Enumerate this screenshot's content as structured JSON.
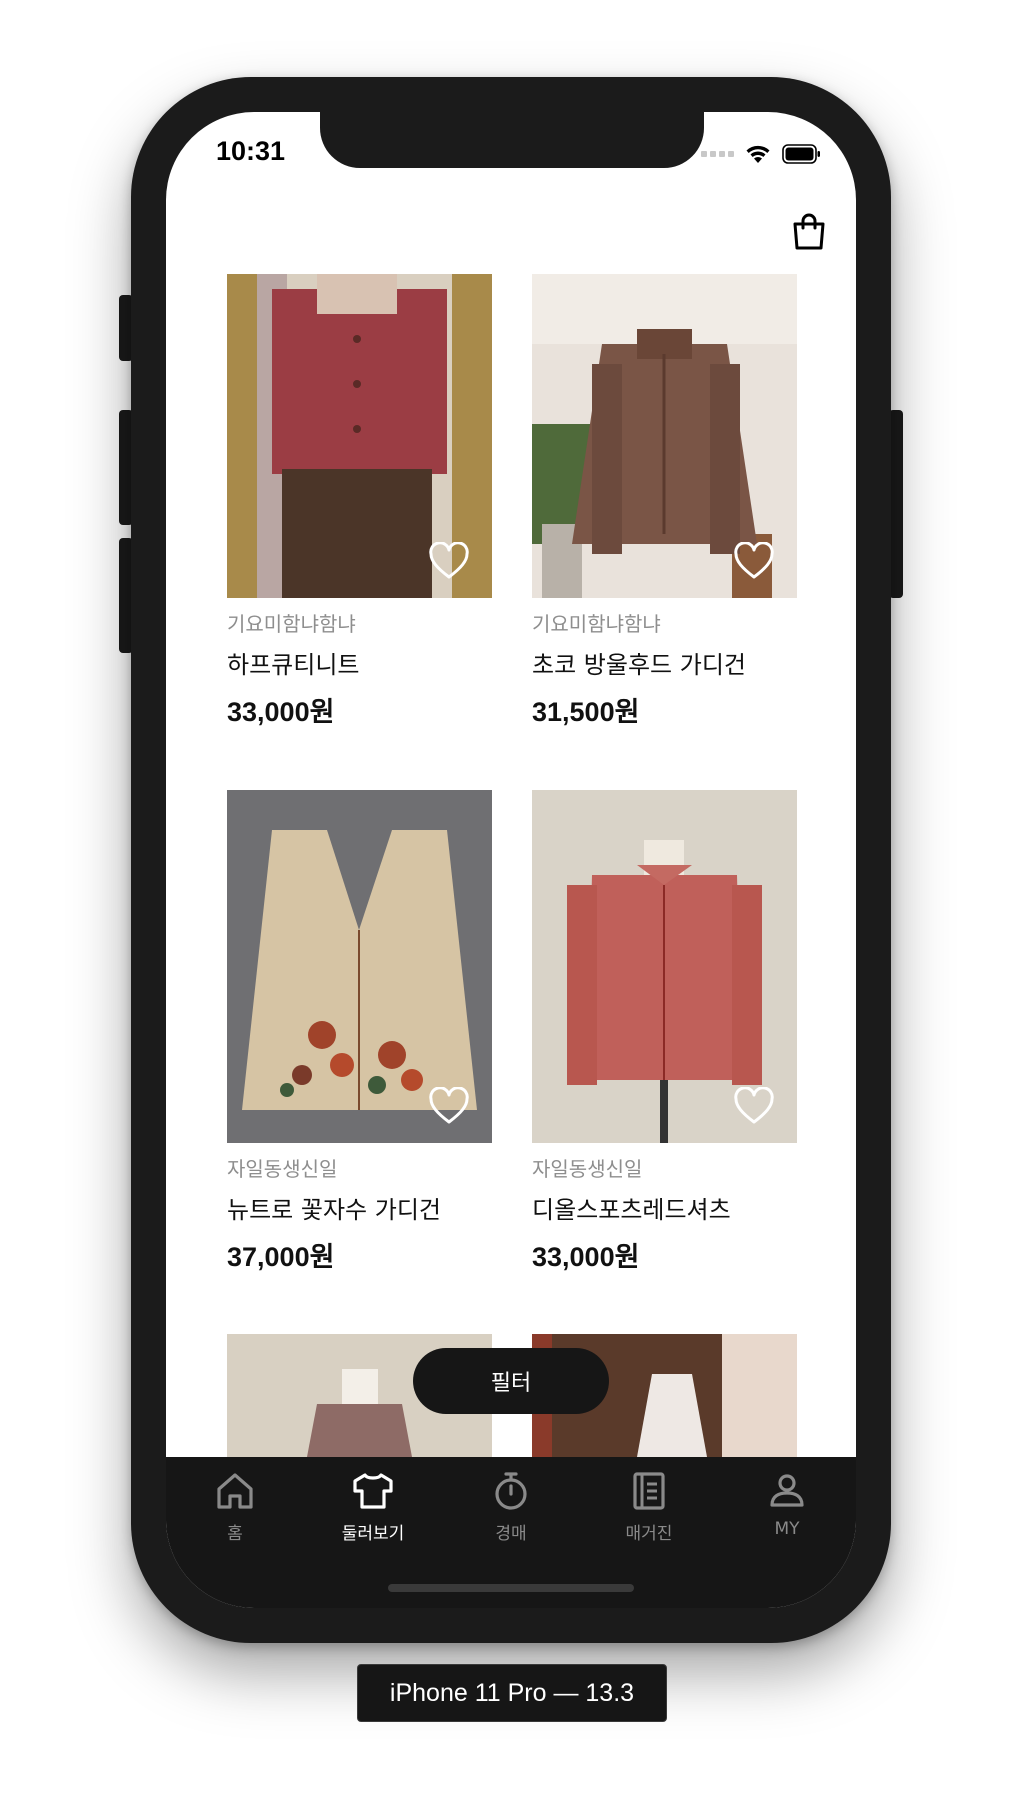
{
  "status_bar": {
    "time": "10:31"
  },
  "header": {
    "bag_icon": "shopping-bag-icon"
  },
  "products": [
    {
      "seller": "기요미함냐함냐",
      "name": "하프큐티니트",
      "price": "33,000원"
    },
    {
      "seller": "기요미함냐함냐",
      "name": "초코 방울후드 가디건",
      "price": "31,500원"
    },
    {
      "seller": "자일동생신일",
      "name": "뉴트로 꽃자수 가디건",
      "price": "37,000원"
    },
    {
      "seller": "자일동생신일",
      "name": "디올스포츠레드셔츠",
      "price": "33,000원"
    }
  ],
  "filter_button": {
    "label": "필터"
  },
  "tab_bar": {
    "items": [
      {
        "label": "홈",
        "icon": "home-icon"
      },
      {
        "label": "둘러보기",
        "icon": "tshirt-icon"
      },
      {
        "label": "경매",
        "icon": "stopwatch-icon"
      },
      {
        "label": "매거진",
        "icon": "magazine-icon"
      },
      {
        "label": "MY",
        "icon": "person-icon"
      }
    ],
    "active": "둘러보기"
  },
  "device_label": "iPhone 11 Pro — 13.3",
  "colors": {
    "tab_bar_bg": "#161616",
    "active_tab": "#ffffff",
    "inactive_tab": "#8a8a8a",
    "seller_text": "#8e8e8e"
  }
}
